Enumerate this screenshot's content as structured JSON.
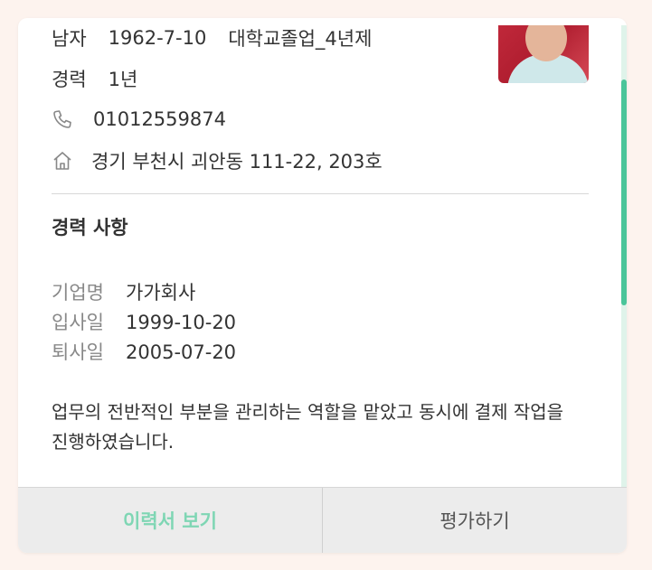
{
  "profile": {
    "gender": "남자",
    "birth": "1962-7-10",
    "education": "대학교졸업_4년제",
    "career_label": "경력",
    "career_years": "1년",
    "phone": "01012559874",
    "address": "경기 부천시 괴안동 111-22,  203호"
  },
  "career_section": {
    "title": "경력 사항",
    "company_label": "기업명",
    "company": "가가회사",
    "join_label": "입사일",
    "join_date": "1999-10-20",
    "leave_label": "퇴사일",
    "leave_date": "2005-07-20",
    "description": "업무의 전반적인 부분을 관리하는 역할을 맡았고 동시에 결제 작업을 진행하였습니다."
  },
  "footer": {
    "resume_button": "이력서 보기",
    "rate_button": "평가하기"
  },
  "icons": {
    "phone": "phone-icon",
    "home": "home-icon"
  },
  "colors": {
    "accent": "#4ac59a",
    "resume_text": "#7fd6b4",
    "footer_bg": "#ececec"
  }
}
